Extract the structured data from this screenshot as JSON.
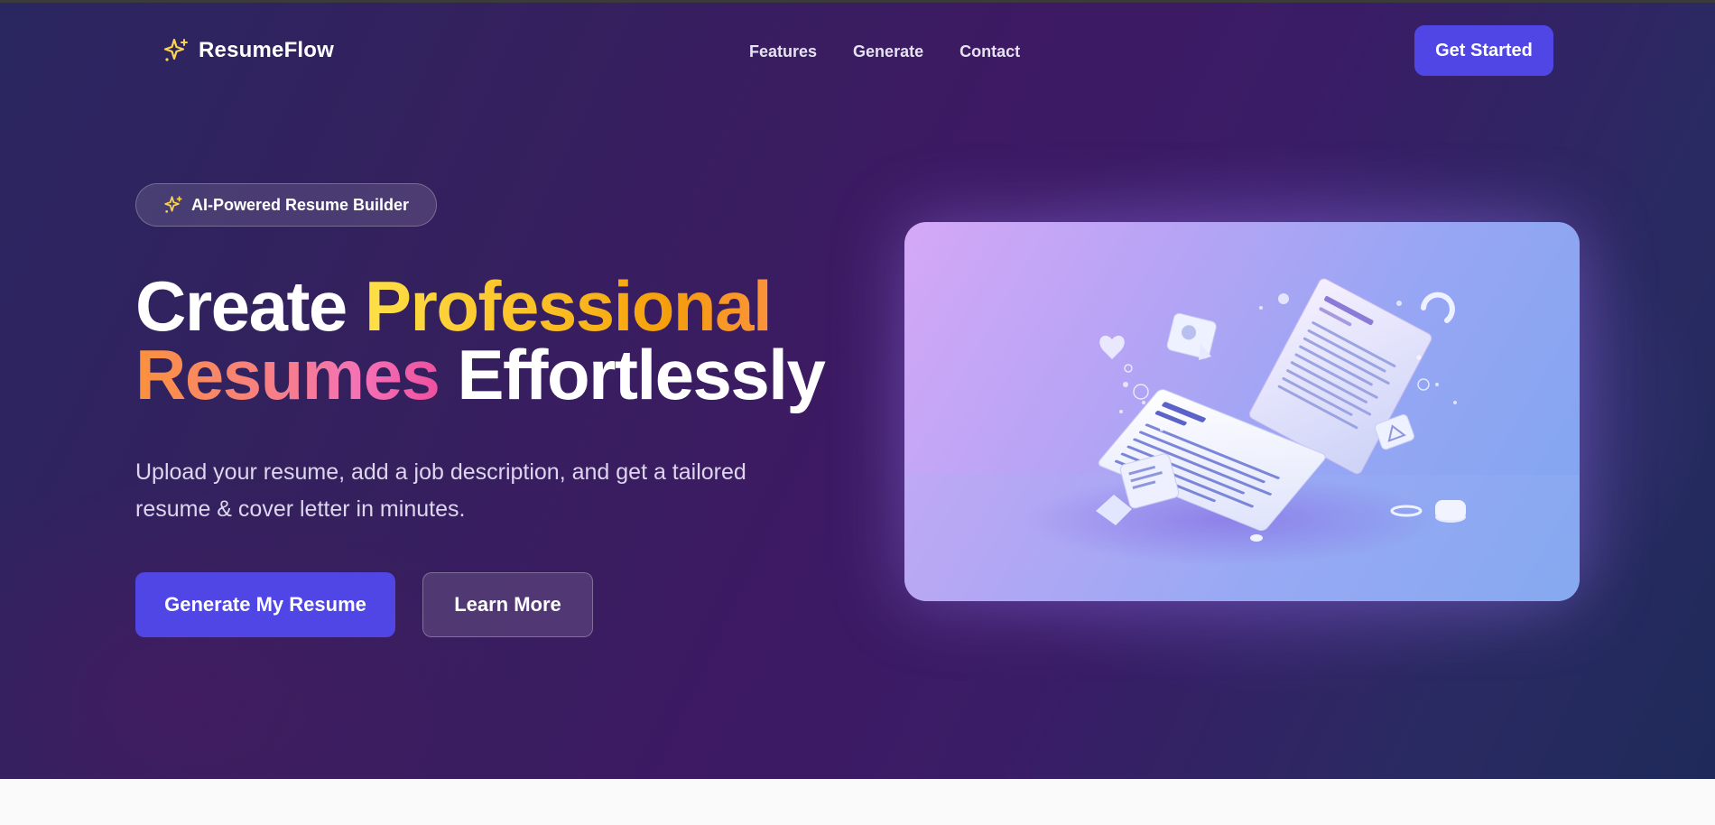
{
  "brand": {
    "name": "ResumeFlow",
    "icon": "sparkle-icon",
    "accent": "#4f46e5",
    "icon_color": "#fcd34d"
  },
  "nav": {
    "links": [
      "Features",
      "Generate",
      "Contact"
    ],
    "cta": "Get Started"
  },
  "hero": {
    "badge": {
      "icon": "sparkle-icon",
      "label": "AI-Powered Resume Builder"
    },
    "headline": {
      "w1": "Create",
      "w2": "Professional",
      "w3": "Resumes",
      "w4": "Effortlessly"
    },
    "subtitle": "Upload your resume, add a job description, and get a tailored resume & cover letter in minutes.",
    "primary_button": "Generate My Resume",
    "secondary_button": "Learn More",
    "image": {
      "icon": "resume-documents-illustration"
    }
  },
  "colors": {
    "background_gradient_start": "#2a2660",
    "background_gradient_mid": "#3d1a63",
    "headline_yellow": "#fbbf24",
    "headline_pink": "#f472b6"
  }
}
